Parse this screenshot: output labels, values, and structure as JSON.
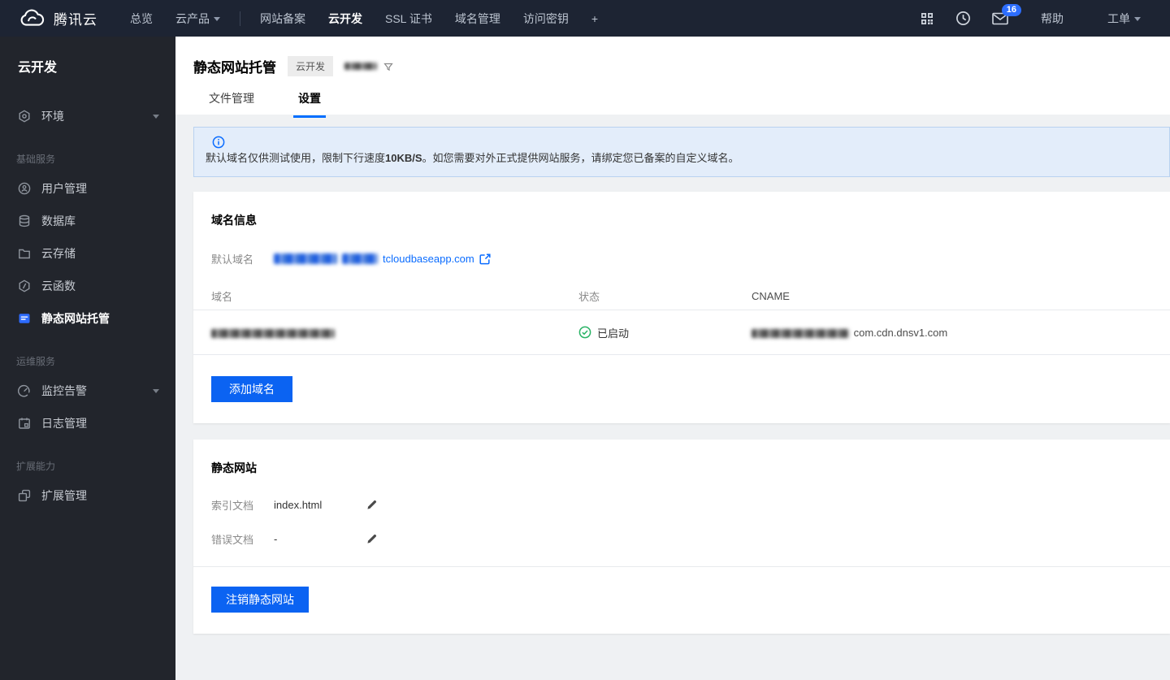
{
  "topnav": {
    "brand": "腾讯云",
    "overview": "总览",
    "products": "云产品",
    "items": [
      "网站备案",
      "云开发",
      "SSL 证书",
      "域名管理",
      "访问密钥"
    ],
    "plus": "+",
    "mail_badge": "16",
    "help": "帮助",
    "ticket": "工单"
  },
  "sidebar": {
    "title": "云开发",
    "env": "环境",
    "section1": "基础服务",
    "items1": [
      "用户管理",
      "数据库",
      "云存储",
      "云函数",
      "静态网站托管"
    ],
    "section2": "运维服务",
    "items2": [
      "监控告警",
      "日志管理"
    ],
    "section3": "扩展能力",
    "items3": [
      "扩展管理"
    ]
  },
  "header": {
    "title": "静态网站托管",
    "badge": "云开发"
  },
  "tabs": {
    "files": "文件管理",
    "settings": "设置"
  },
  "banner": {
    "pre": "默认域名仅供测试使用，限制下行速度",
    "bold": "10KB/S",
    "post": "。如您需要对外正式提供网站服务，请绑定您已备案的自定义域名。"
  },
  "domain_card": {
    "title": "域名信息",
    "default_label": "默认域名",
    "default_visible": "tcloudbaseapp.com",
    "col_domain": "域名",
    "col_status": "状态",
    "col_cname": "CNAME",
    "row_status": "已启动",
    "row_cname_visible": "com.cdn.dnsv1.com",
    "add_button": "添加域名"
  },
  "site_card": {
    "title": "静态网站",
    "index_label": "索引文档",
    "index_value": "index.html",
    "error_label": "错误文档",
    "error_value": "-",
    "deregister_button": "注销静态网站"
  },
  "colors": {
    "accent": "#006eff",
    "success": "#29b365",
    "navbar_bg": "#1d2433",
    "sidebar_bg": "#22252c",
    "banner_bg": "#e3edfa",
    "banner_border": "#b9d2f0"
  }
}
